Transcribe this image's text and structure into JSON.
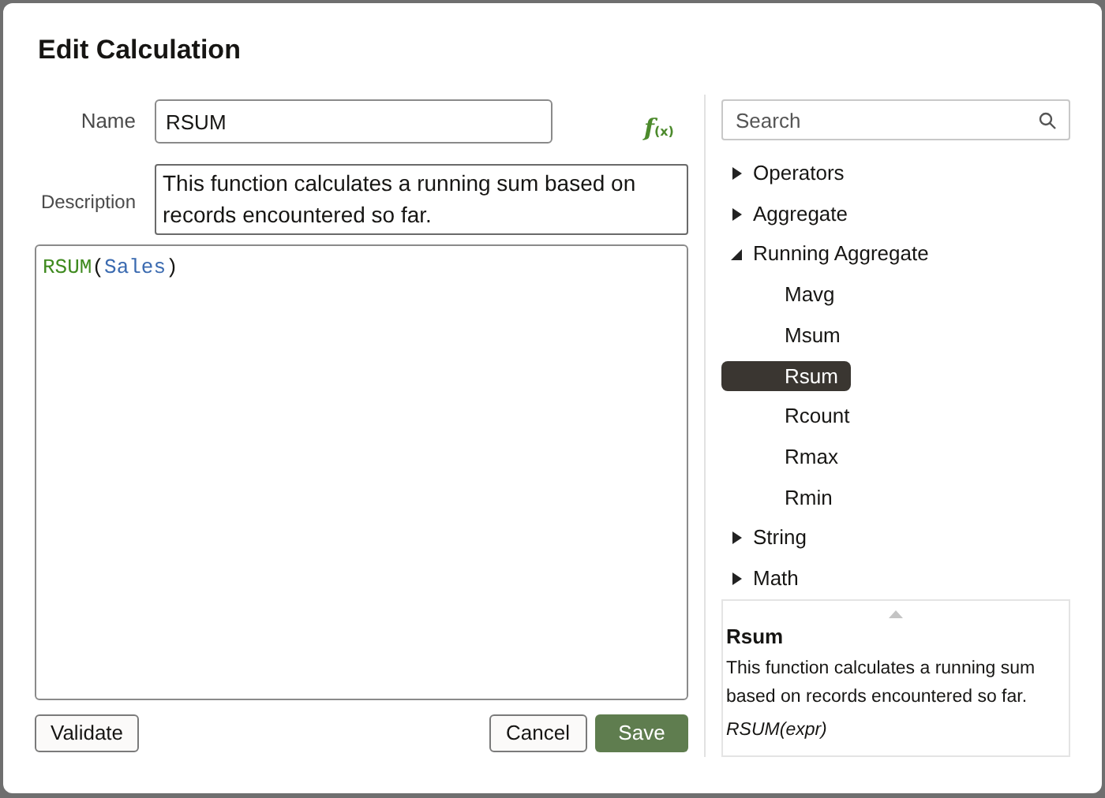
{
  "dialog": {
    "title": "Edit Calculation"
  },
  "name_field": {
    "label": "Name",
    "value": "RSUM"
  },
  "description_field": {
    "label": "Description",
    "value": "This function calculates a running sum based on records encountered so far."
  },
  "editor": {
    "tokens": [
      {
        "kind": "function",
        "text": "RSUM"
      },
      {
        "kind": "punct",
        "text": "("
      },
      {
        "kind": "column",
        "text": "Sales"
      },
      {
        "kind": "punct",
        "text": ")"
      }
    ]
  },
  "function_button": {
    "symbol": "f",
    "argument": "(x)"
  },
  "search": {
    "placeholder": "Search"
  },
  "tree": [
    {
      "label": "Operators",
      "expanded": false,
      "selected": false
    },
    {
      "label": "Aggregate",
      "expanded": false,
      "selected": false
    },
    {
      "label": "Running Aggregate",
      "expanded": true,
      "selected": false,
      "children": [
        {
          "label": "Mavg",
          "selected": false
        },
        {
          "label": "Msum",
          "selected": false
        },
        {
          "label": "Rsum",
          "selected": true
        },
        {
          "label": "Rcount",
          "selected": false
        },
        {
          "label": "Rmax",
          "selected": false
        },
        {
          "label": "Rmin",
          "selected": false
        }
      ]
    },
    {
      "label": "String",
      "expanded": false,
      "selected": false
    },
    {
      "label": "Math",
      "expanded": false,
      "selected": false
    }
  ],
  "help": {
    "title": "Rsum",
    "description": "This function calculates a running sum based on records encountered so far.",
    "syntax": "RSUM(expr)"
  },
  "buttons": {
    "validate": "Validate",
    "cancel": "Cancel",
    "save": "Save"
  }
}
